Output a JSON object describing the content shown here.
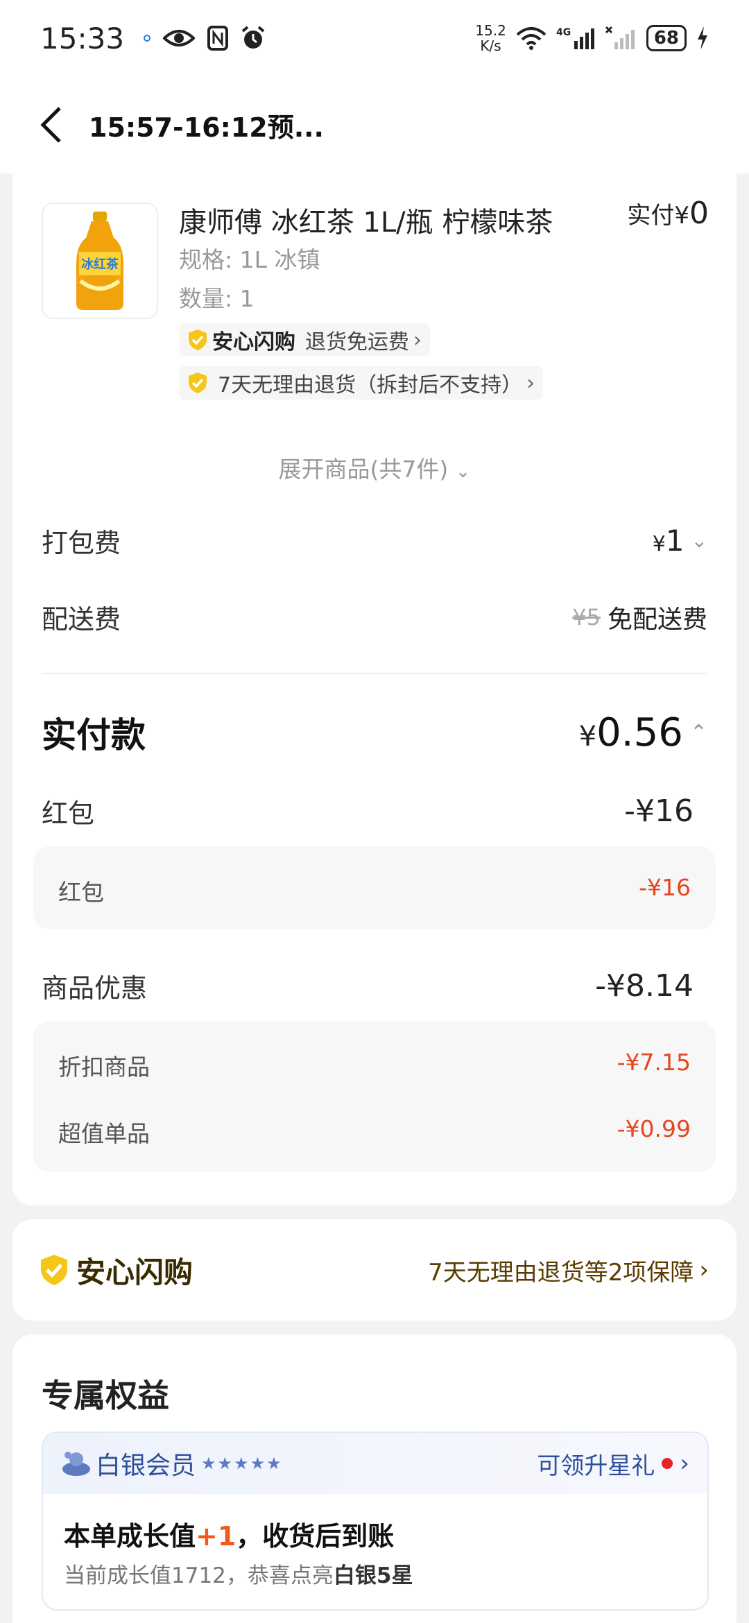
{
  "status_bar": {
    "time": "15:33",
    "speed_value": "15.2",
    "speed_unit": "K/s",
    "network": "4G",
    "battery": "68"
  },
  "nav": {
    "title": "15:57-16:12预..."
  },
  "product": {
    "name": "康师傅 冰红茶 1L/瓶 柠檬味茶",
    "pay_label": "实付",
    "pay_currency": "¥",
    "pay_value": "0",
    "spec": "规格: 1L 冰镇",
    "quantity": "数量: 1",
    "tag1_brand": "安心闪购",
    "tag1_text": "退货免运费",
    "tag2_text": "7天无理由退货（拆封后不支持）",
    "expand_label": "展开商品(共7件)"
  },
  "fees": {
    "packing_label": "打包费",
    "packing_currency": "¥",
    "packing_value": "1",
    "delivery_label": "配送费",
    "delivery_original": "¥5",
    "delivery_value": "免配送费"
  },
  "total": {
    "label": "实付款",
    "currency": "¥",
    "value": "0.56"
  },
  "red_packet": {
    "label": "红包",
    "value": "-¥16",
    "sub_label": "红包",
    "sub_value": "-¥16"
  },
  "discount": {
    "label": "商品优惠",
    "value": "-¥8.14",
    "items": [
      {
        "label": "折扣商品",
        "value": "-¥7.15"
      },
      {
        "label": "超值单品",
        "value": "-¥0.99"
      }
    ]
  },
  "guarantee": {
    "title": "安心闪购",
    "link": "7天无理由退货等2项保障"
  },
  "benefits": {
    "title": "专属权益",
    "member_name": "白银会员",
    "stars": "★★★★★",
    "link": "可领升星礼",
    "growth_prefix": "本单成长值",
    "growth_plus": "+1",
    "growth_suffix": "，收货后到账",
    "current_prefix": "当前成长值1712，恭喜点亮",
    "current_level": "白银5星"
  },
  "colors": {
    "accent_red": "#e5451f",
    "member_blue": "#2d4f9c",
    "guard_yellow": "#f5c518"
  }
}
